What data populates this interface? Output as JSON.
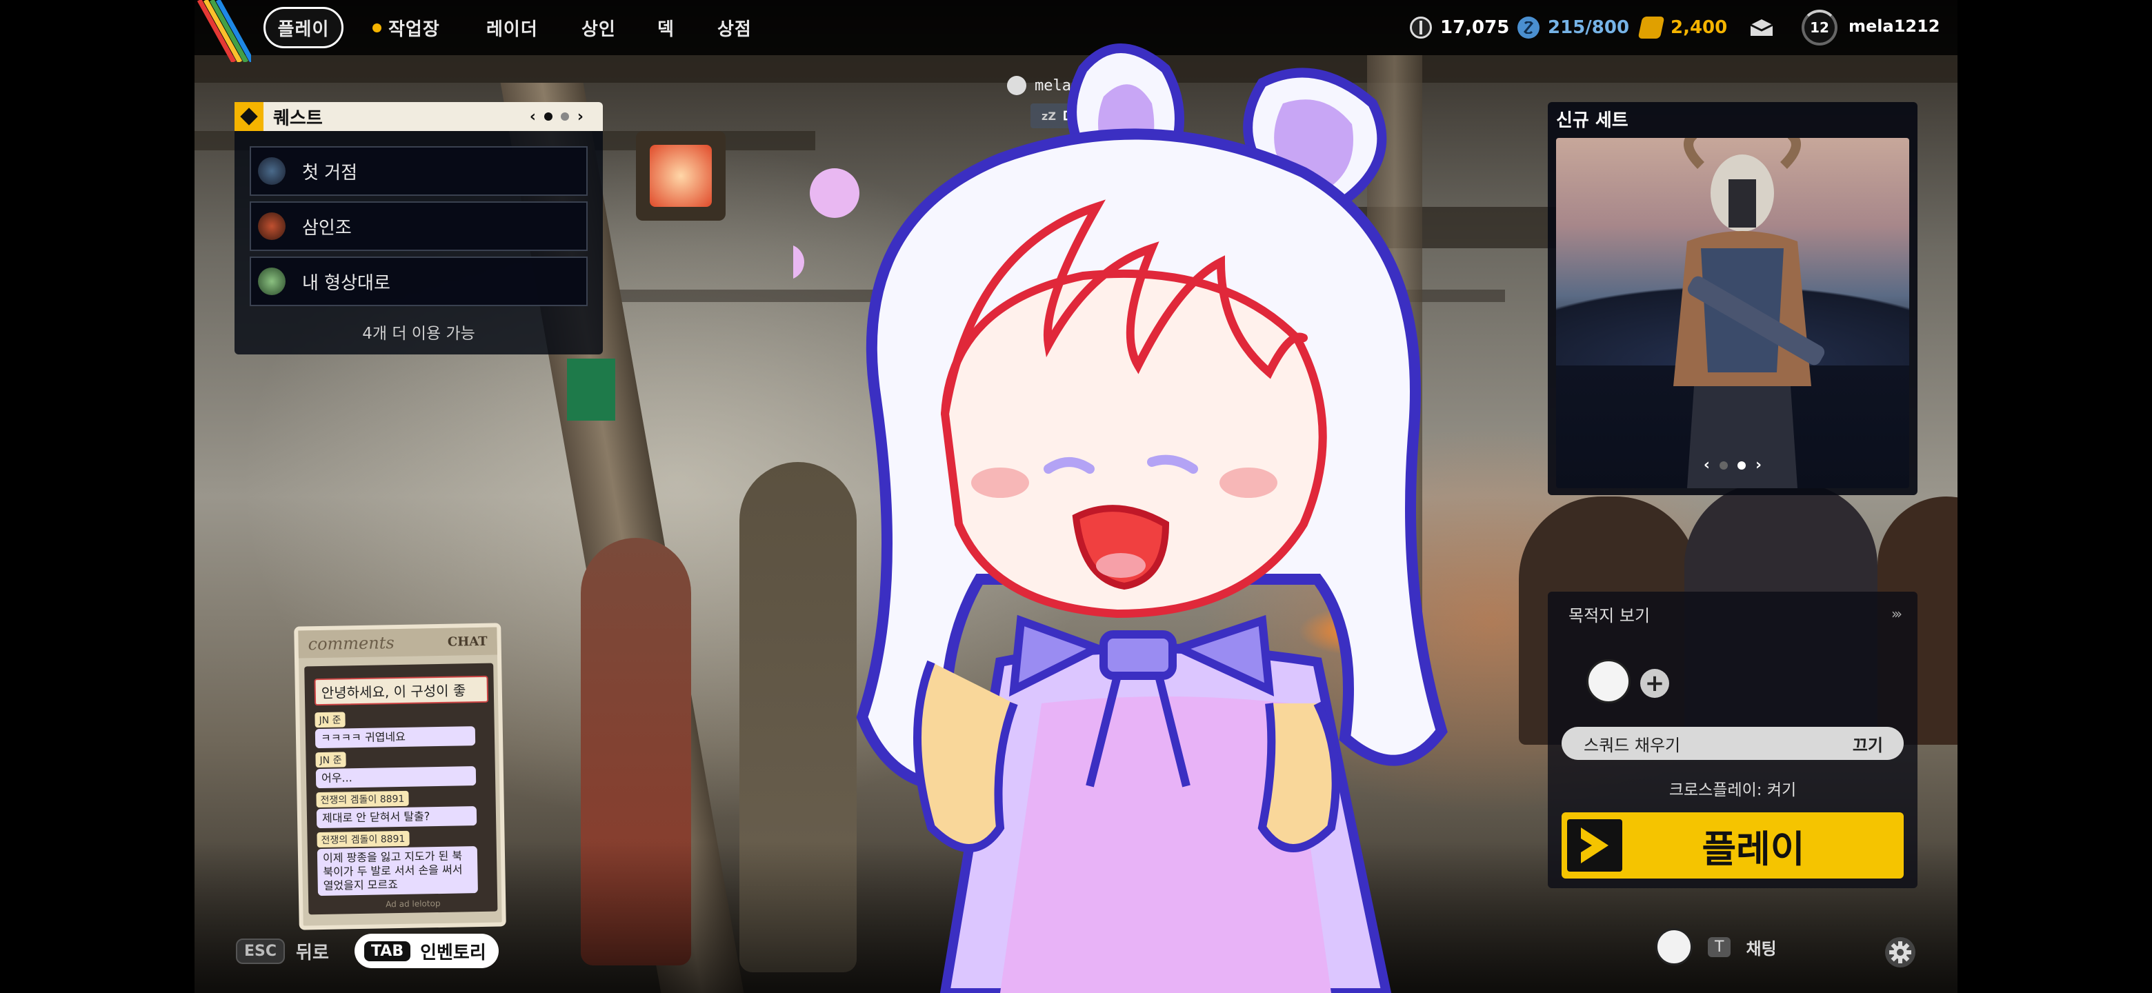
{
  "top_nav": {
    "play": "플레이",
    "workshop": "작업장",
    "raider": "레이더",
    "trader": "상인",
    "deck": "덱",
    "shop": "상점"
  },
  "resources": {
    "credits": "17,075",
    "silver": "215/800",
    "gold": "2,400"
  },
  "profile": {
    "level": "12",
    "username": "mela1212"
  },
  "quest": {
    "title": "퀘스트",
    "items": [
      {
        "label": "첫 거점"
      },
      {
        "label": "삼인조"
      },
      {
        "label": "내 형상대로"
      }
    ],
    "more": "4개 더 이용 가능",
    "page_arrows": {
      "prev": "‹",
      "next": "›"
    }
  },
  "player_overhead": {
    "name": "mela1212",
    "status": "대기",
    "status_icon": "zZ"
  },
  "new_set": {
    "title": "신규 세트",
    "arrows": {
      "prev": "‹",
      "next": "›"
    }
  },
  "lobby": {
    "destination": "목적지 보기",
    "fill_squad_label": "스쿼드 채우기",
    "fill_squad_value": "끄기",
    "crossplay": "크로스플레이: 켜기",
    "play_button": "플레이"
  },
  "bottom_hints": {
    "back_key": "ESC",
    "back_label": "뒤로",
    "inventory_key": "TAB",
    "inventory_label": "인벤토리",
    "chat_key": "T",
    "chat_label": "채팅"
  },
  "chat_sticker": {
    "header_left": "comments",
    "header_right": "CHAT",
    "banner": "안녕하세요, 이 구성이 좋",
    "messages": [
      {
        "name": "JN 준",
        "text": "ㅋㅋㅋㅋ 귀엽네요"
      },
      {
        "name": "JN 준",
        "text": "어우..."
      },
      {
        "name": "전쟁의 겜돌이 8891",
        "text": "제대로 안 닫혀서 탈출?"
      },
      {
        "name": "전쟁의 겜돌이 8891",
        "text": "이제 팡종을 잃고 지도가 된 북북이가 두 발로 서서 손을 써서 열었을지 모르죠"
      }
    ],
    "footer": "Ad   ad   lelotop"
  },
  "colors": {
    "accent_yellow": "#f5c400",
    "silver": "#76b3e6",
    "gold": "#f5b400",
    "avatar_outline": "#3b2fc2",
    "avatar_red": "#e0283a",
    "avatar_lilac": "#c8a6f5"
  },
  "icons": [
    "quest-diamond-icon",
    "credits-icon",
    "silver-icon",
    "gold-icon",
    "mail-icon",
    "level-ring-icon",
    "crown-icon",
    "add-icon",
    "play-chevron-icon",
    "settings-gear-icon"
  ]
}
